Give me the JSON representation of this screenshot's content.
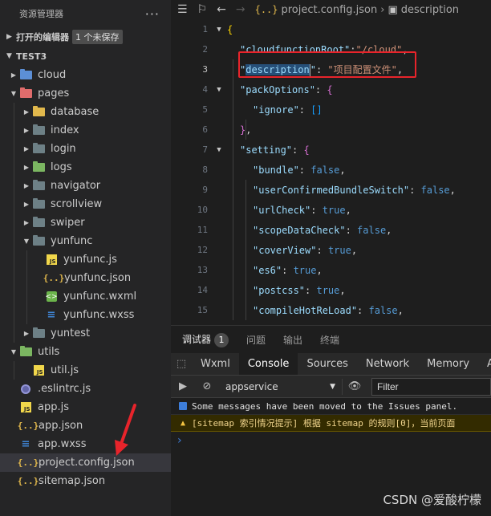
{
  "sidebar": {
    "title": "资源管理器",
    "more_label": "···",
    "open_editors": {
      "label": "打开的编辑器",
      "badge": "1 个未保存"
    },
    "project": {
      "label": "TEST3"
    },
    "tree": [
      {
        "label": "cloud",
        "kind": "folder",
        "color": "blue",
        "depth": 1,
        "arrow": "›"
      },
      {
        "label": "pages",
        "kind": "folder",
        "color": "red",
        "depth": 1,
        "arrow": "⌄"
      },
      {
        "label": "database",
        "kind": "folder",
        "color": "yellow",
        "depth": 2,
        "arrow": "›"
      },
      {
        "label": "index",
        "kind": "folder",
        "color": "gray",
        "depth": 2,
        "arrow": "›"
      },
      {
        "label": "login",
        "kind": "folder",
        "color": "gray",
        "depth": 2,
        "arrow": "›"
      },
      {
        "label": "logs",
        "kind": "folder",
        "color": "green",
        "depth": 2,
        "arrow": "›"
      },
      {
        "label": "navigator",
        "kind": "folder",
        "color": "gray",
        "depth": 2,
        "arrow": "›"
      },
      {
        "label": "scrollview",
        "kind": "folder",
        "color": "gray",
        "depth": 2,
        "arrow": "›"
      },
      {
        "label": "swiper",
        "kind": "folder",
        "color": "gray",
        "depth": 2,
        "arrow": "›"
      },
      {
        "label": "yunfunc",
        "kind": "folder",
        "color": "gray",
        "depth": 2,
        "arrow": "⌄"
      },
      {
        "label": "yunfunc.js",
        "kind": "js",
        "depth": 3
      },
      {
        "label": "yunfunc.json",
        "kind": "json",
        "depth": 3
      },
      {
        "label": "yunfunc.wxml",
        "kind": "wxml",
        "depth": 3
      },
      {
        "label": "yunfunc.wxss",
        "kind": "wxss",
        "depth": 3
      },
      {
        "label": "yuntest",
        "kind": "folder",
        "color": "gray",
        "depth": 2,
        "arrow": "›"
      },
      {
        "label": "utils",
        "kind": "folder",
        "color": "green",
        "depth": 1,
        "arrow": "⌄"
      },
      {
        "label": "util.js",
        "kind": "js",
        "depth": 2
      },
      {
        "label": ".eslintrc.js",
        "kind": "eslint",
        "depth": 1
      },
      {
        "label": "app.js",
        "kind": "js",
        "depth": 1
      },
      {
        "label": "app.json",
        "kind": "json",
        "depth": 1
      },
      {
        "label": "app.wxss",
        "kind": "wxss",
        "depth": 1
      },
      {
        "label": "project.config.json",
        "kind": "json",
        "depth": 1,
        "selected": true
      },
      {
        "label": "sitemap.json",
        "kind": "json",
        "depth": 1
      }
    ]
  },
  "editor": {
    "breadcrumb": {
      "file": "project.config.json",
      "symbol": "description"
    },
    "lines": [
      {
        "n": "1",
        "fold": "⌄",
        "indent": 0,
        "tokens": [
          [
            "{",
            "brace"
          ]
        ]
      },
      {
        "n": "2",
        "indent": 1,
        "tokens": [
          [
            "\"cloudfunctionRoot\"",
            "key"
          ],
          [
            ":",
            "punc"
          ],
          [
            "\"/cloud\"",
            "str"
          ],
          [
            ",",
            "punc"
          ]
        ]
      },
      {
        "n": "3",
        "indent": 1,
        "current": true,
        "tokens": [
          [
            "\"",
            "key"
          ],
          [
            "description",
            "keysel"
          ],
          [
            "|",
            "cursor"
          ],
          [
            "\"",
            "key"
          ],
          [
            ": ",
            "punc"
          ],
          [
            "\"项目配置文件\"",
            "str"
          ],
          [
            ",",
            "punc"
          ]
        ]
      },
      {
        "n": "4",
        "fold": "⌄",
        "indent": 1,
        "tokens": [
          [
            "\"packOptions\"",
            "key"
          ],
          [
            ": ",
            "punc"
          ],
          [
            "{",
            "brace2"
          ]
        ]
      },
      {
        "n": "5",
        "indent": 2,
        "tokens": [
          [
            "\"ignore\"",
            "key"
          ],
          [
            ": ",
            "punc"
          ],
          [
            "[]",
            "brace3"
          ]
        ]
      },
      {
        "n": "6",
        "indent": 1,
        "tokens": [
          [
            "}",
            "brace2"
          ],
          [
            ",",
            "punc"
          ]
        ]
      },
      {
        "n": "7",
        "fold": "⌄",
        "indent": 1,
        "tokens": [
          [
            "\"setting\"",
            "key"
          ],
          [
            ": ",
            "punc"
          ],
          [
            "{",
            "brace2"
          ]
        ]
      },
      {
        "n": "8",
        "indent": 2,
        "tokens": [
          [
            "\"bundle\"",
            "key"
          ],
          [
            ": ",
            "punc"
          ],
          [
            "false",
            "bool"
          ],
          [
            ",",
            "punc"
          ]
        ]
      },
      {
        "n": "9",
        "indent": 2,
        "tokens": [
          [
            "\"userConfirmedBundleSwitch\"",
            "key"
          ],
          [
            ": ",
            "punc"
          ],
          [
            "false",
            "bool"
          ],
          [
            ",",
            "punc"
          ]
        ]
      },
      {
        "n": "10",
        "indent": 2,
        "tokens": [
          [
            "\"urlCheck\"",
            "key"
          ],
          [
            ": ",
            "punc"
          ],
          [
            "true",
            "bool"
          ],
          [
            ",",
            "punc"
          ]
        ]
      },
      {
        "n": "11",
        "indent": 2,
        "tokens": [
          [
            "\"scopeDataCheck\"",
            "key"
          ],
          [
            ": ",
            "punc"
          ],
          [
            "false",
            "bool"
          ],
          [
            ",",
            "punc"
          ]
        ]
      },
      {
        "n": "12",
        "indent": 2,
        "tokens": [
          [
            "\"coverView\"",
            "key"
          ],
          [
            ": ",
            "punc"
          ],
          [
            "true",
            "bool"
          ],
          [
            ",",
            "punc"
          ]
        ]
      },
      {
        "n": "13",
        "indent": 2,
        "tokens": [
          [
            "\"es6\"",
            "key"
          ],
          [
            ": ",
            "punc"
          ],
          [
            "true",
            "bool"
          ],
          [
            ",",
            "punc"
          ]
        ]
      },
      {
        "n": "14",
        "indent": 2,
        "tokens": [
          [
            "\"postcss\"",
            "key"
          ],
          [
            ": ",
            "punc"
          ],
          [
            "true",
            "bool"
          ],
          [
            ",",
            "punc"
          ]
        ]
      },
      {
        "n": "15",
        "indent": 2,
        "tokens": [
          [
            "\"compileHotReLoad\"",
            "key"
          ],
          [
            ": ",
            "punc"
          ],
          [
            "false",
            "bool"
          ],
          [
            ",",
            "punc"
          ]
        ]
      }
    ]
  },
  "devtools": {
    "tabs": [
      {
        "label": "调试器",
        "active": true,
        "count": "1"
      },
      {
        "label": "问题"
      },
      {
        "label": "输出"
      },
      {
        "label": "终端"
      }
    ],
    "panel_tabs": [
      "Wxml",
      "Console",
      "Sources",
      "Network",
      "Memory",
      "A"
    ],
    "active_panel": "Console",
    "context": "appservice",
    "filter_placeholder": "Filter",
    "messages": [
      {
        "type": "info",
        "text": "Some messages have been moved to the Issues panel."
      },
      {
        "type": "warn",
        "text": "[sitemap 索引情况提示] 根据 sitemap 的规则[0]，当前页面"
      }
    ],
    "prompt": "›"
  },
  "watermark": "CSDN @爱酸柠檬",
  "colors": {
    "annotation": "#e8242b",
    "accent": "#3d7dd9"
  }
}
